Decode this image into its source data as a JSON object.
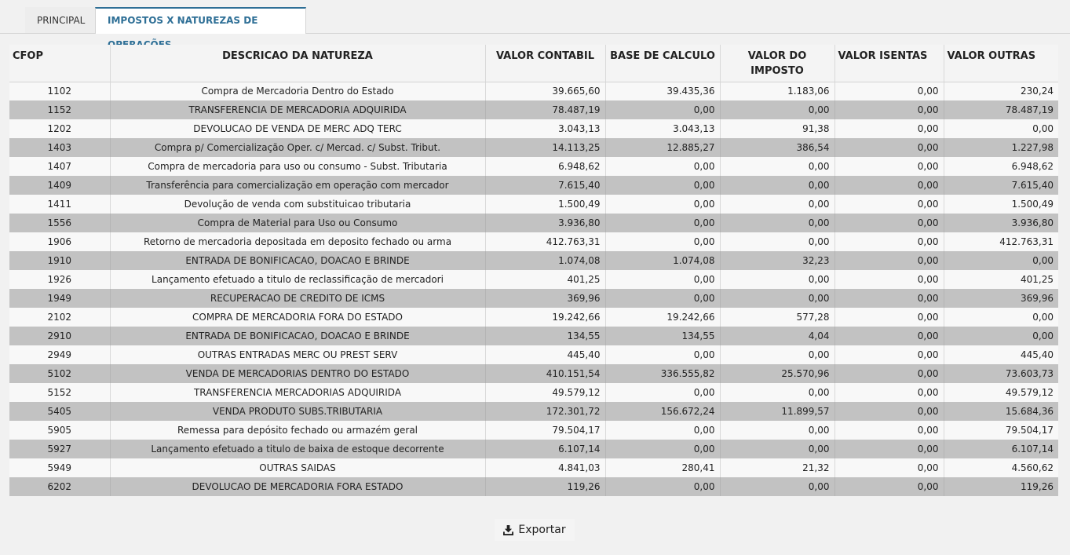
{
  "tabs": [
    {
      "label": "PRINCIPAL"
    },
    {
      "label": "IMPOSTOS X NATUREZAS DE OPERAÇÕES"
    }
  ],
  "table": {
    "headers": [
      "CFOP",
      "DESCRICAO DA NATUREZA",
      "VALOR CONTABIL",
      "BASE DE CALCULO",
      "VALOR DO IMPOSTO",
      "VALOR ISENTAS",
      "VALOR OUTRAS"
    ],
    "rows": [
      [
        "1102",
        "Compra de Mercadoria Dentro do Estado",
        "39.665,60",
        "39.435,36",
        "1.183,06",
        "0,00",
        "230,24"
      ],
      [
        "1152",
        "TRANSFERENCIA DE MERCADORIA ADQUIRIDA",
        "78.487,19",
        "0,00",
        "0,00",
        "0,00",
        "78.487,19"
      ],
      [
        "1202",
        "DEVOLUCAO DE VENDA DE MERC ADQ TERC",
        "3.043,13",
        "3.043,13",
        "91,38",
        "0,00",
        "0,00"
      ],
      [
        "1403",
        "Compra p/ Comercialização Oper. c/ Mercad. c/ Subst. Tribut.",
        "14.113,25",
        "12.885,27",
        "386,54",
        "0,00",
        "1.227,98"
      ],
      [
        "1407",
        "Compra de mercadoria para uso ou consumo - Subst. Tributaria",
        "6.948,62",
        "0,00",
        "0,00",
        "0,00",
        "6.948,62"
      ],
      [
        "1409",
        "Transferência para comercialização em operação com mercador",
        "7.615,40",
        "0,00",
        "0,00",
        "0,00",
        "7.615,40"
      ],
      [
        "1411",
        "Devolução de venda com substituicao tributaria",
        "1.500,49",
        "0,00",
        "0,00",
        "0,00",
        "1.500,49"
      ],
      [
        "1556",
        "Compra de Material para Uso ou Consumo",
        "3.936,80",
        "0,00",
        "0,00",
        "0,00",
        "3.936,80"
      ],
      [
        "1906",
        "Retorno de mercadoria depositada em deposito fechado ou arma",
        "412.763,31",
        "0,00",
        "0,00",
        "0,00",
        "412.763,31"
      ],
      [
        "1910",
        "ENTRADA DE BONIFICACAO, DOACAO E BRINDE",
        "1.074,08",
        "1.074,08",
        "32,23",
        "0,00",
        "0,00"
      ],
      [
        "1926",
        "Lançamento efetuado a titulo de reclassificação de mercadori",
        "401,25",
        "0,00",
        "0,00",
        "0,00",
        "401,25"
      ],
      [
        "1949",
        "RECUPERACAO DE CREDITO DE ICMS",
        "369,96",
        "0,00",
        "0,00",
        "0,00",
        "369,96"
      ],
      [
        "2102",
        "COMPRA DE MERCADORIA FORA DO ESTADO",
        "19.242,66",
        "19.242,66",
        "577,28",
        "0,00",
        "0,00"
      ],
      [
        "2910",
        "ENTRADA DE BONIFICACAO, DOACAO E BRINDE",
        "134,55",
        "134,55",
        "4,04",
        "0,00",
        "0,00"
      ],
      [
        "2949",
        "OUTRAS ENTRADAS MERC OU PREST SERV",
        "445,40",
        "0,00",
        "0,00",
        "0,00",
        "445,40"
      ],
      [
        "5102",
        "VENDA DE MERCADORIAS DENTRO DO ESTADO",
        "410.151,54",
        "336.555,82",
        "25.570,96",
        "0,00",
        "73.603,73"
      ],
      [
        "5152",
        "TRANSFERENCIA MERCADORIAS ADQUIRIDA",
        "49.579,12",
        "0,00",
        "0,00",
        "0,00",
        "49.579,12"
      ],
      [
        "5405",
        "VENDA PRODUTO SUBS.TRIBUTARIA",
        "172.301,72",
        "156.672,24",
        "11.899,57",
        "0,00",
        "15.684,36"
      ],
      [
        "5905",
        "Remessa para depósito fechado ou armazém geral",
        "79.504,17",
        "0,00",
        "0,00",
        "0,00",
        "79.504,17"
      ],
      [
        "5927",
        "Lançamento efetuado a titulo de baixa de estoque decorrente",
        "6.107,14",
        "0,00",
        "0,00",
        "0,00",
        "6.107,14"
      ],
      [
        "5949",
        "OUTRAS SAIDAS",
        "4.841,03",
        "280,41",
        "21,32",
        "0,00",
        "4.560,62"
      ],
      [
        "6202",
        "DEVOLUCAO DE MERCADORIA FORA ESTADO",
        "119,26",
        "0,00",
        "0,00",
        "0,00",
        "119,26"
      ]
    ]
  },
  "export": {
    "label": "Exportar",
    "icon": "download-icon"
  },
  "colors": {
    "accent": "#2e6f96",
    "row_light": "#f8f8f8",
    "row_dark": "#c2c2c2",
    "background": "#f1f1f1"
  }
}
